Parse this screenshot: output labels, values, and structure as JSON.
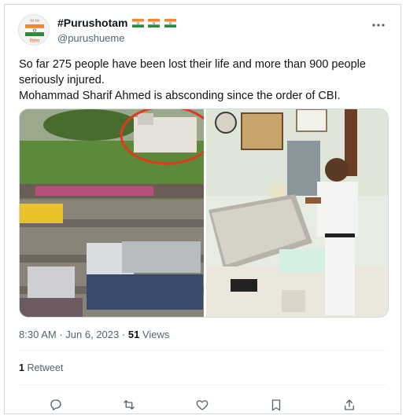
{
  "tweet": {
    "display_name": "#Purushotam",
    "handle": "@purushueme",
    "avatar_caption": "घर घर",
    "avatar_caption2": "तिरंगा",
    "text_line1": "So far 275 people have been lost their life and  more than 900 people seriously injured.",
    "text_line2": "Mohammad Sharif Ahmed is absconding since the order of CBI.",
    "time": "8:30 AM",
    "separator": "·",
    "date": "Jun 6, 2023",
    "separator2": "·",
    "views_count": "51",
    "views_label": "Views",
    "retweets_count": "1",
    "retweets_label": "Retweet"
  },
  "icons": {
    "more": "more-horizontal-icon",
    "reply": "reply-icon",
    "retweet": "retweet-icon",
    "like": "heart-icon",
    "bookmark": "bookmark-icon",
    "share": "share-icon"
  },
  "colors": {
    "secondary_text": "#536471",
    "border": "#cfd9de",
    "saffron": "#f4882a",
    "india_green": "#2e8b3a",
    "highlight_circle": "#e0391b"
  }
}
